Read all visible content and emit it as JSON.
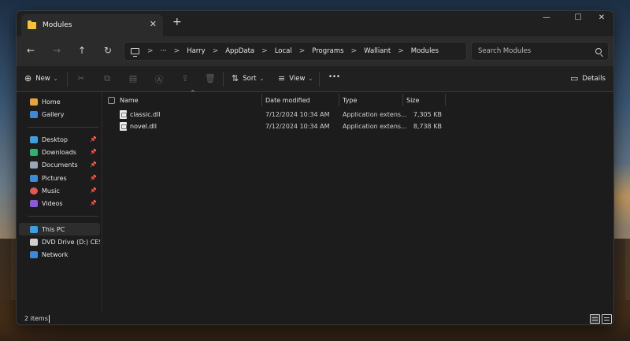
{
  "window": {
    "tab_title": "Modules",
    "tab_close": "✕",
    "new_tab": "+",
    "minimize": "—",
    "maximize": "☐",
    "close": "✕"
  },
  "nav": {
    "back": "←",
    "forward": "→",
    "up": "↑",
    "refresh": "↻"
  },
  "address": {
    "overflow": "···",
    "breadcrumbs": [
      "Harry",
      "AppData",
      "Local",
      "Programs",
      "Walliant",
      "Modules"
    ]
  },
  "search": {
    "placeholder": "Search Modules"
  },
  "toolbar": {
    "new_label": "New",
    "sort_label": "Sort",
    "view_label": "View",
    "more_label": "•••",
    "details_label": "Details"
  },
  "sidebar": {
    "items": [
      {
        "label": "Home",
        "color": "#e8a33d"
      },
      {
        "label": "Gallery",
        "color": "#3b8ad9"
      },
      {
        "label": "Desktop",
        "color": "#3aa0e0"
      },
      {
        "label": "Downloads",
        "color": "#2fb06d"
      },
      {
        "label": "Documents",
        "color": "#9aa6b8"
      },
      {
        "label": "Pictures",
        "color": "#3b8ad9"
      },
      {
        "label": "Music",
        "color": "#e05a4f"
      },
      {
        "label": "Videos",
        "color": "#8a5ad9"
      },
      {
        "label": "This PC",
        "color": "#3aa0e0"
      },
      {
        "label": "DVD Drive (D:) CES_X",
        "color": "#cfcfcf"
      },
      {
        "label": "Network",
        "color": "#3b8ad9"
      }
    ]
  },
  "columns": {
    "name": "Name",
    "date": "Date modified",
    "type": "Type",
    "size": "Size"
  },
  "files": [
    {
      "name": "classic.dll",
      "date": "7/12/2024 10:34 AM",
      "type": "Application extens...",
      "size": "7,305 KB"
    },
    {
      "name": "novel.dll",
      "date": "7/12/2024 10:34 AM",
      "type": "Application extens...",
      "size": "8,738 KB"
    }
  ],
  "status": {
    "item_count": "2 items"
  }
}
